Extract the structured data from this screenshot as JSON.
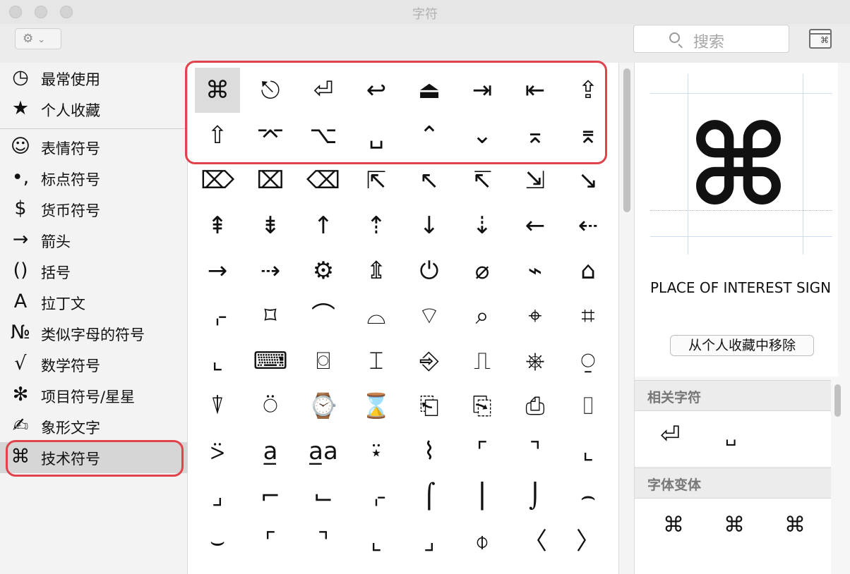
{
  "window": {
    "title": "字符"
  },
  "toolbar": {
    "gear_glyph": "⚙",
    "chevron": "⌄",
    "search_placeholder": "搜索"
  },
  "sidebar": {
    "items": [
      {
        "icon": "◷",
        "icon_name": "clock-icon",
        "label": "最常使用"
      },
      {
        "icon": "★",
        "icon_name": "star-icon",
        "label": "个人收藏"
      },
      {
        "icon": "☺",
        "icon_name": "smiley-icon",
        "label": "表情符号"
      },
      {
        "icon": "•,",
        "icon_name": "punctuation-icon",
        "label": "标点符号"
      },
      {
        "icon": "$",
        "icon_name": "dollar-icon",
        "label": "货币符号"
      },
      {
        "icon": "→",
        "icon_name": "arrow-icon",
        "label": "箭头"
      },
      {
        "icon": "()",
        "icon_name": "parentheses-icon",
        "label": "括号"
      },
      {
        "icon": "A",
        "icon_name": "latin-a-icon",
        "label": "拉丁文"
      },
      {
        "icon": "№",
        "icon_name": "numero-icon",
        "label": "类似字母的符号"
      },
      {
        "icon": "√",
        "icon_name": "square-root-icon",
        "label": "数学符号"
      },
      {
        "icon": "✻",
        "icon_name": "asterisk-icon",
        "label": "项目符号/星星"
      },
      {
        "icon": "✍",
        "icon_name": "writing-hand-icon",
        "label": "象形文字"
      },
      {
        "icon": "⌘",
        "icon_name": "command-key-icon",
        "label": "技术符号"
      }
    ],
    "selected_index": 12
  },
  "grid": {
    "rows": [
      [
        "⌘",
        "⎋",
        "⏎",
        "↩",
        "⏏",
        "⇥",
        "⇤",
        "⇪"
      ],
      [
        "⇧",
        "⌤",
        "⌥",
        "␣",
        "⌃",
        "⌄",
        "⌅",
        "⌆"
      ],
      [
        "⌦",
        "⌧",
        "⌫",
        "⇱",
        "↖",
        "↸",
        "⇲",
        "↘"
      ],
      [
        "⇞",
        "⇟",
        "↑",
        "⇡",
        "↓",
        "⇣",
        "←",
        "⇠"
      ],
      [
        "→",
        "⇢",
        "⚙",
        "⇭",
        "⏻",
        "⌀",
        "⌁",
        "⌂"
      ],
      [
        "⌌",
        "⌑",
        "⌒",
        "⌓",
        "⌔",
        "⌕",
        "⌖",
        "⌗"
      ],
      [
        "⌞",
        "⌨",
        "⌼",
        "⌶",
        "⎆",
        "⎍",
        "⎈",
        "⍜"
      ],
      [
        "⍒",
        "⍥",
        "⌚",
        "⌛",
        "⎗",
        "⎘",
        "⎙",
        "⌷"
      ],
      [
        "⍩",
        "a̲",
        "a̲a",
        "⍣",
        "⌇",
        "⌜",
        "⌝",
        "⌞"
      ],
      [
        "⌟",
        "⌐",
        "⌙",
        "⌌",
        "⌠",
        "⎮",
        "⌡",
        "⌢"
      ],
      [
        "⌣",
        "⌜",
        "⌝",
        "⌞",
        "⌟",
        "⌽",
        "〈",
        "〉"
      ]
    ],
    "selected": "⌘"
  },
  "inspector": {
    "glyph": "⌘",
    "name": "PLACE OF INTEREST SIGN",
    "remove_button": "从个人收藏中移除",
    "related_title": "相关字符",
    "related": [
      "⏎",
      "␣"
    ],
    "variants_title": "字体变体",
    "variants": [
      "⌘",
      "⌘",
      "⌘"
    ]
  }
}
